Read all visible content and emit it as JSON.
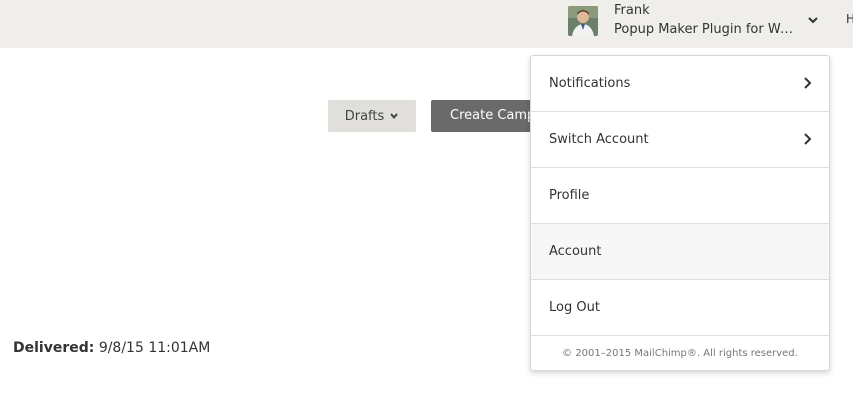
{
  "header": {
    "user_name": "Frank",
    "account_name": "Popup Maker Plugin for Wo...",
    "cutoff_text": "H"
  },
  "toolbar": {
    "drafts_label": "Drafts",
    "create_label": "Create Campaign"
  },
  "campaign": {
    "delivered_label": "Delivered:",
    "delivered_value": "9/8/15 11:01AM"
  },
  "menu": {
    "items": [
      {
        "label": "Notifications",
        "has_submenu": true
      },
      {
        "label": "Switch Account",
        "has_submenu": true
      },
      {
        "label": "Profile",
        "has_submenu": false
      },
      {
        "label": "Account",
        "has_submenu": false,
        "highlighted": true
      },
      {
        "label": "Log Out",
        "has_submenu": false
      }
    ],
    "footer": "© 2001–2015 MailChimp®. All rights reserved."
  },
  "icons": {
    "avatar": "user-avatar",
    "dropdown": "chevron-down-icon",
    "submenu": "chevron-right-icon"
  },
  "colors": {
    "topbar_bg": "#efeeea",
    "drafts_bg": "#e0dfdb",
    "create_bg": "#6a6a6a"
  }
}
